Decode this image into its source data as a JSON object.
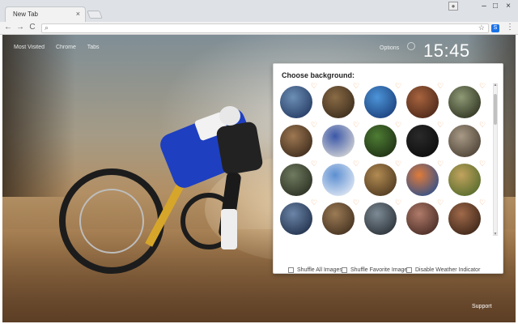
{
  "browser": {
    "tab_title": "New Tab",
    "tab_close": "×",
    "win_user_icon": "user-icon",
    "win_minimize": "–",
    "win_maximize": "□",
    "win_close": "×",
    "nav_back": "←",
    "nav_forward": "→",
    "nav_reload": "C",
    "omni_search_glyph": "⌕",
    "omni_star": "☆",
    "ext_label": "S",
    "menu_glyph": "⋮"
  },
  "page": {
    "top_links": [
      "Most Visited",
      "Chrome",
      "Tabs"
    ],
    "options_link": "Options",
    "clock": "15:45",
    "support_link": "Support",
    "accent_orange": "#f4a261"
  },
  "panel": {
    "title": "Choose background:",
    "heart_glyph": "♡",
    "thumbnails": [
      {
        "row": 0,
        "col": 0,
        "colors": [
          "#6d8fb5",
          "#243a63"
        ]
      },
      {
        "row": 0,
        "col": 1,
        "colors": [
          "#8a6b45",
          "#3b2c1d"
        ]
      },
      {
        "row": 0,
        "col": 2,
        "colors": [
          "#4c95d9",
          "#1b3e7a"
        ]
      },
      {
        "row": 0,
        "col": 3,
        "colors": [
          "#a8643e",
          "#4a2618"
        ]
      },
      {
        "row": 0,
        "col": 4,
        "colors": [
          "#8f9a76",
          "#2e3320"
        ]
      },
      {
        "row": 1,
        "col": 0,
        "colors": [
          "#9e7852",
          "#3c2a1b"
        ]
      },
      {
        "row": 1,
        "col": 1,
        "colors": [
          "#3b57a8",
          "#d6d6d6"
        ]
      },
      {
        "row": 1,
        "col": 2,
        "colors": [
          "#4e7d34",
          "#1d2e13"
        ]
      },
      {
        "row": 1,
        "col": 3,
        "colors": [
          "#2a2a2a",
          "#0c0c0c"
        ]
      },
      {
        "row": 1,
        "col": 4,
        "colors": [
          "#a89a86",
          "#4b4034"
        ]
      },
      {
        "row": 2,
        "col": 0,
        "colors": [
          "#6f7b5f",
          "#2b2f22"
        ]
      },
      {
        "row": 2,
        "col": 1,
        "colors": [
          "#5c8fd1",
          "#e2e9f4"
        ]
      },
      {
        "row": 2,
        "col": 2,
        "colors": [
          "#b28b52",
          "#4d3820"
        ]
      },
      {
        "row": 2,
        "col": 3,
        "colors": [
          "#e07b3a",
          "#2d4f8c"
        ]
      },
      {
        "row": 2,
        "col": 4,
        "colors": [
          "#c2a35e",
          "#536a2b"
        ]
      },
      {
        "row": 3,
        "col": 0,
        "colors": [
          "#6c85a8",
          "#20304a"
        ]
      },
      {
        "row": 3,
        "col": 1,
        "colors": [
          "#9c7b55",
          "#42301f"
        ]
      },
      {
        "row": 3,
        "col": 2,
        "colors": [
          "#7d8b96",
          "#2a3036"
        ]
      },
      {
        "row": 3,
        "col": 3,
        "colors": [
          "#b07b6a",
          "#472a23"
        ]
      },
      {
        "row": 3,
        "col": 4,
        "colors": [
          "#a06a4a",
          "#3b2417"
        ]
      }
    ],
    "options": [
      {
        "label": "Shuffle All Images",
        "checked": false
      },
      {
        "label": "Shuffle Favorite Images",
        "checked": false
      },
      {
        "label": "Disable Weather Indicator",
        "checked": false
      }
    ]
  }
}
